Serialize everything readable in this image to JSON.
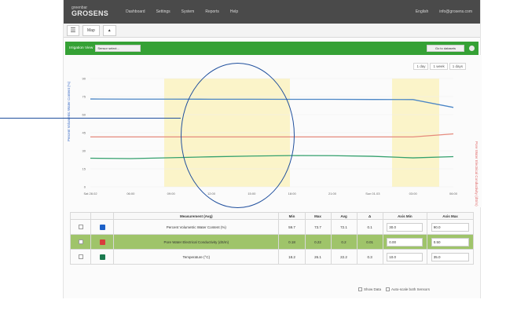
{
  "app": {
    "brand_small": "greenbar",
    "brand": "GROSENS"
  },
  "nav": {
    "items": [
      "Dashboard",
      "Settings",
      "System",
      "Reports",
      "Help"
    ],
    "right": [
      "English",
      "info@grosens.com"
    ]
  },
  "tabs": {
    "menu_icon": "hamburger-icon",
    "items": [
      "Map",
      "▲"
    ]
  },
  "toolbar": {
    "label": "Irrigation View",
    "select_value": "Sensor select...",
    "right_button": "Go to datasets",
    "right_icon": "gear-icon"
  },
  "chart_controls": {
    "items": [
      "1 day",
      "1 week",
      "1 days"
    ]
  },
  "chart_data": {
    "type": "line",
    "title": "",
    "xlabel": "",
    "ylabel": "Percent Volumetric Water Content (%)",
    "y2label": "Pore Water Electrical Conductivity (dS/m)",
    "x": [
      "Sat 28.02",
      "06:00",
      "09:00",
      "12:00",
      "15:00",
      "18:00",
      "21:00",
      "Sun 01.03",
      "03:00",
      "06:00"
    ],
    "series": [
      {
        "name": "Percent Volumetric Water Content (%)",
        "color": "#4b86c6",
        "values": [
          73.0,
          72.9,
          72.9,
          72.8,
          72.8,
          72.7,
          72.7,
          72.6,
          72.5,
          66.0
        ]
      },
      {
        "name": "Pore Water Electrical Conductivity (dS/m)",
        "color": "#e58a7d",
        "values": [
          41.5,
          41.5,
          41.5,
          41.5,
          41.5,
          41.5,
          41.5,
          41.5,
          41.5,
          44.0
        ]
      },
      {
        "name": "Temperature (°C)",
        "color": "#35a16e",
        "values": [
          23.8,
          23.5,
          24.2,
          25.0,
          25.6,
          26.0,
          25.9,
          25.4,
          24.1,
          25.1
        ]
      }
    ],
    "ylim": [
      0,
      90
    ],
    "grid": true,
    "legend": "none"
  },
  "table": {
    "headers": [
      "",
      "",
      "Measurement (Avg)",
      "Min",
      "Max",
      "Avg",
      "Δ",
      "Axis Min",
      "Axis Max"
    ],
    "rows": [
      {
        "color": "#1d61c8",
        "name": "Percent Volumetric Water Content (%)",
        "min": "59.7",
        "max": "73.7",
        "avg": "72.1",
        "delta": "0.1",
        "axis_min": "30.0",
        "axis_max": "90.0"
      },
      {
        "color": "#d93c3c",
        "name": "Pore Water Electrical Conductivity (dS/m)",
        "min": "0.18",
        "max": "0.22",
        "avg": "0.2",
        "delta": "0.01",
        "axis_min": "0.00",
        "axis_max": "0.50"
      },
      {
        "color": "#1b7a4f",
        "name": "Temperature (°C)",
        "min": "18.2",
        "max": "26.1",
        "avg": "22.2",
        "delta": "0.3",
        "axis_min": "10.0",
        "axis_max": "35.0"
      }
    ]
  },
  "footer": {
    "options": [
      "Show Data",
      "Auto-scale both Sensors"
    ]
  }
}
